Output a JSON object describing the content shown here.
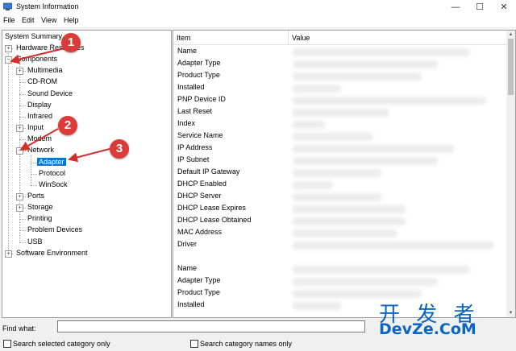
{
  "window": {
    "title": "System Information",
    "minimize_glyph": "—",
    "maximize_glyph": "☐",
    "close_glyph": "✕"
  },
  "menu": [
    "File",
    "Edit",
    "View",
    "Help"
  ],
  "tree": {
    "system_summary": "System Summary",
    "hardware_resources": "Hardware Resources",
    "components": "Components",
    "components_children": [
      "Multimedia",
      "CD-ROM",
      "Sound Device",
      "Display",
      "Infrared",
      "Input",
      "Modem",
      "Network"
    ],
    "network_children": [
      "Adapter",
      "Protocol",
      "WinSock"
    ],
    "components_tail": [
      "Ports",
      "Storage",
      "Printing",
      "Problem Devices",
      "USB"
    ],
    "software_environment": "Software Environment",
    "selected": "Adapter"
  },
  "details": {
    "columns": [
      "Item",
      "Value"
    ],
    "items": [
      "Name",
      "Adapter Type",
      "Product Type",
      "Installed",
      "PNP Device ID",
      "Last Reset",
      "Index",
      "Service Name",
      "IP Address",
      "IP Subnet",
      "Default IP Gateway",
      "DHCP Enabled",
      "DHCP Server",
      "DHCP Lease Expires",
      "DHCP Lease Obtained",
      "MAC Address",
      "Driver",
      "",
      "Name",
      "Adapter Type",
      "Product Type",
      "Installed"
    ]
  },
  "find": {
    "label": "Find what:",
    "value": "",
    "search_selected_label": "Search selected category only",
    "search_names_label": "Search category names only"
  },
  "annotations": [
    "1",
    "2",
    "3"
  ],
  "watermark": {
    "main": "开 发 者",
    "sub": "DevZe.CoM"
  },
  "colors": {
    "selection": "#0078d7",
    "annotation": "#dd3a3a",
    "arrow": "#d32f2f",
    "watermark": "#0a66c2"
  }
}
